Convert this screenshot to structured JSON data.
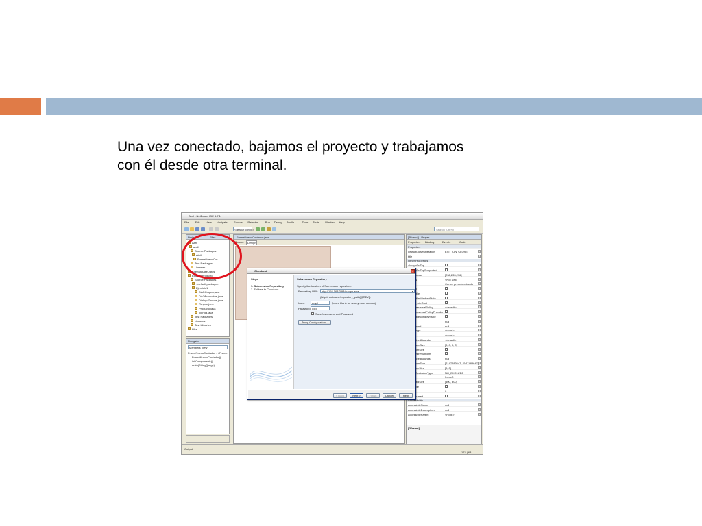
{
  "slide": {
    "caption_line1": "Una vez conectado, bajamos el proyecto y trabajamos",
    "caption_line2": "con él desde otra terminal.",
    "colors": {
      "accent": "#e07b47",
      "title_bar": "#9fb8d1",
      "circle": "#e0141e"
    }
  },
  "ide": {
    "window_title": "Abril - NetBeans IDE 6.7.1",
    "menu": [
      "File",
      "Edit",
      "View",
      "Navigate",
      "Source",
      "Refactor",
      "Run",
      "Debug",
      "Profile",
      "Team",
      "Tools",
      "Window",
      "Help"
    ],
    "config_combo": "<default config>",
    "search_placeholder": "Search (Ctrl+I)",
    "projects_tab": "Projects",
    "files_tab": "Files",
    "tree": [
      "Abril",
      "abril",
      "Source Packages",
      "Abril",
      "FrameNuevoCor",
      "Test Packages",
      "Libraries",
      "AgendaBaseDatos",
      "ExamenProducto",
      "Source Packages",
      "<default package>",
      "Ejercicio1",
      "DAOGrupos.java",
      "DAOProductos.java",
      "DialogoGrupos.java",
      "Grupos.java",
      "Producto.java",
      "Tienda.java",
      "Test Packages",
      "Libraries",
      "Test Libraries",
      "Libs"
    ],
    "navigator": {
      "title": "Navigator",
      "view": "Members View",
      "items": [
        "FrameNuevoContador :: JFrame",
        "FrameNuevoContador()",
        "initComponents()",
        "main(String[] args)"
      ]
    },
    "editor": {
      "tab": "FrameNuevoContador.java",
      "source_tab": "Source",
      "design_tab": "Design"
    },
    "properties": {
      "header": "[JFrame] - Proper...",
      "tabs": [
        "Properties",
        "Binding",
        "Events",
        "Code"
      ],
      "rows": [
        {
          "name": "Properties",
          "value": "",
          "kind": "section"
        },
        {
          "name": "defaultCloseOperation",
          "value": "EXIT_ON_CLOSE",
          "kind": "text"
        },
        {
          "name": "title",
          "value": "",
          "kind": "text"
        },
        {
          "name": "Other Properties",
          "value": "",
          "kind": "section"
        },
        {
          "name": "alwaysOnTop",
          "value": "",
          "kind": "check"
        },
        {
          "name": "alwaysOnTopSupported",
          "value": "",
          "kind": "check"
        },
        {
          "name": "background",
          "value": "[236,233,216]",
          "kind": "text"
        },
        {
          "name": "bounds",
          "value": "<Not Set>",
          "kind": "text"
        },
        {
          "name": "cursor",
          "value": "Cursor predeterminado",
          "kind": "text"
        },
        {
          "name": "enabled",
          "value": "",
          "kind": "check"
        },
        {
          "name": "focusable",
          "value": "",
          "kind": "check"
        },
        {
          "name": "focusableWindowState",
          "value": "",
          "kind": "check"
        },
        {
          "name": "focusCycleRoot",
          "value": "",
          "kind": "check"
        },
        {
          "name": "focusTraversalPolicy",
          "value": "<default>",
          "kind": "text"
        },
        {
          "name": "focusTraversalPolicyProvider",
          "value": "",
          "kind": "check"
        },
        {
          "name": "focusableWindowState",
          "value": "",
          "kind": "check"
        },
        {
          "name": "font",
          "value": "null",
          "kind": "text"
        },
        {
          "name": "foreground",
          "value": "null",
          "kind": "text"
        },
        {
          "name": "iconImage",
          "value": "<none>",
          "kind": "text"
        },
        {
          "name": "locale",
          "value": "<none>",
          "kind": "text"
        },
        {
          "name": "maximizedBounds",
          "value": "<default>",
          "kind": "text"
        },
        {
          "name": "maximumSize",
          "value": "[0, 0, 0, 0]",
          "kind": "text"
        },
        {
          "name": "minimumSize",
          "value": "",
          "kind": "check"
        },
        {
          "name": "locationByPlatform",
          "value": "",
          "kind": "check"
        },
        {
          "name": "maximizedBounds",
          "value": "null",
          "kind": "text"
        },
        {
          "name": "maximumSize",
          "value": "[2147483647, 2147483647]",
          "kind": "text"
        },
        {
          "name": "minimumSize",
          "value": "[0, 0]",
          "kind": "text"
        },
        {
          "name": "modalExclusionType",
          "value": "NO_EXCLUDE",
          "kind": "text"
        },
        {
          "name": "name",
          "value": "frame0",
          "kind": "text"
        },
        {
          "name": "preferredSize",
          "value": "[400, 300]",
          "kind": "text"
        },
        {
          "name": "resizable",
          "value": "",
          "kind": "check"
        },
        {
          "name": "state",
          "value": "0",
          "kind": "text"
        },
        {
          "name": "undecorated",
          "value": "",
          "kind": "check"
        },
        {
          "name": "Accessibility",
          "value": "",
          "kind": "section"
        },
        {
          "name": "accessibleName",
          "value": "null",
          "kind": "text"
        },
        {
          "name": "accessibleDescription",
          "value": "null",
          "kind": "text"
        },
        {
          "name": "accessibleParent",
          "value": "<none>",
          "kind": "text"
        }
      ],
      "footer": "[JFrame]"
    },
    "status": {
      "output": "Output",
      "position": "172 | 63"
    }
  },
  "dialog": {
    "title": "Checkout",
    "steps_title": "Steps",
    "steps": [
      "1.  Subversion Repository",
      "2.  Folders to Checkout"
    ],
    "section": "Subversion Repository",
    "instruction": "Specify the location of Subversion repository.",
    "url_label": "Repository URL:",
    "url_value": "http://192.168.3.93/svn/prueba",
    "url_hint": "(http://hostname/repository_path[@REV])",
    "user_label": "User:",
    "user_value": "empl",
    "user_hint": "(leave blank for anonymous access)",
    "password_label": "Password:",
    "password_value": "•••••",
    "save_label": "Save Username and Password",
    "proxy_button": "Proxy Configuration...",
    "buttons": [
      "< Back",
      "Next >",
      "Finish",
      "Cancel",
      "Help"
    ]
  }
}
